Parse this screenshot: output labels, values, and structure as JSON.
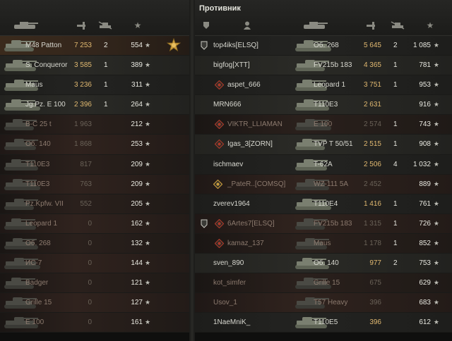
{
  "right_team_title": "Противник",
  "left_rows": [
    {
      "vehicle": "M48 Patton",
      "damage": "7 253",
      "frags": "2",
      "xp": "554",
      "self": true,
      "medal": true
    },
    {
      "vehicle": "S. Conqueror",
      "damage": "3 585",
      "frags": "1",
      "xp": "389"
    },
    {
      "vehicle": "Maus",
      "damage": "3 236",
      "frags": "1",
      "xp": "311"
    },
    {
      "vehicle": "Jg.Pz. E 100",
      "damage": "2 396",
      "frags": "1",
      "xp": "264"
    },
    {
      "vehicle": "B-C 25 t",
      "damage": "1 963",
      "frags": "",
      "xp": "212",
      "dead": true
    },
    {
      "vehicle": "Об. 140",
      "damage": "1 868",
      "frags": "",
      "xp": "253",
      "dead": true
    },
    {
      "vehicle": "T110E3",
      "damage": "817",
      "frags": "",
      "xp": "209",
      "dead": true
    },
    {
      "vehicle": "T110E3",
      "damage": "763",
      "frags": "",
      "xp": "209",
      "dead": true
    },
    {
      "vehicle": "Pz.Kpfw. VII",
      "damage": "552",
      "frags": "",
      "xp": "205",
      "dead": true
    },
    {
      "vehicle": "Leopard 1",
      "damage": "0",
      "frags": "",
      "xp": "162",
      "dead": true
    },
    {
      "vehicle": "Об. 268",
      "damage": "0",
      "frags": "",
      "xp": "132",
      "dead": true
    },
    {
      "vehicle": "ИС-7",
      "damage": "0",
      "frags": "",
      "xp": "144",
      "dead": true
    },
    {
      "vehicle": "Badger",
      "damage": "0",
      "frags": "",
      "xp": "121",
      "dead": true
    },
    {
      "vehicle": "Grille 15",
      "damage": "0",
      "frags": "",
      "xp": "127",
      "dead": true
    },
    {
      "vehicle": "E 100",
      "damage": "0",
      "frags": "",
      "xp": "161",
      "dead": true
    }
  ],
  "right_rows": [
    {
      "player": "top4iks[ELSQ]",
      "vehicle": "Об. 268",
      "damage": "5 645",
      "frags": "2",
      "xp": "1 085",
      "icon": "platoon"
    },
    {
      "player": "bigfog[XTT]",
      "vehicle": "FV215b 183",
      "damage": "4 365",
      "frags": "1",
      "xp": "781"
    },
    {
      "player": "aspet_666",
      "vehicle": "Leopard 1",
      "damage": "3 751",
      "frags": "1",
      "xp": "953",
      "icon": "clan-red"
    },
    {
      "player": "MRN666",
      "vehicle": "T110E3",
      "damage": "2 631",
      "frags": "",
      "xp": "916"
    },
    {
      "player": "VIKTR_LLIAMAN",
      "vehicle": "E 100",
      "damage": "2 574",
      "frags": "1",
      "xp": "743",
      "icon": "clan-red",
      "dead": true
    },
    {
      "player": "Igas_3[ZORN]",
      "vehicle": "TVP T 50/51",
      "damage": "2 515",
      "frags": "1",
      "xp": "908",
      "icon": "clan-red"
    },
    {
      "player": "ischmaev",
      "vehicle": "T-62A",
      "damage": "2 506",
      "frags": "4",
      "xp": "1 032"
    },
    {
      "player": "_PateR..[COMSQ]",
      "vehicle": "WZ-111 5A",
      "damage": "2 452",
      "frags": "",
      "xp": "889",
      "icon": "clan-gold",
      "dead": true
    },
    {
      "player": "zverev1964",
      "vehicle": "T110E4",
      "damage": "1 416",
      "frags": "1",
      "xp": "761"
    },
    {
      "player": "6Artes7[ELSQ]",
      "vehicle": "FV215b 183",
      "damage": "1 315",
      "frags": "1",
      "xp": "726",
      "icon": "platoon-clan",
      "dead": true
    },
    {
      "player": "kamaz_137",
      "vehicle": "Maus",
      "damage": "1 178",
      "frags": "1",
      "xp": "852",
      "icon": "clan-red",
      "dead": true
    },
    {
      "player": "sven_890",
      "vehicle": "Об. 140",
      "damage": "977",
      "frags": "2",
      "xp": "753"
    },
    {
      "player": "kot_simfer",
      "vehicle": "Grille 15",
      "damage": "675",
      "frags": "",
      "xp": "629",
      "dead": true
    },
    {
      "player": "Usov_1",
      "vehicle": "T57 Heavy",
      "damage": "396",
      "frags": "",
      "xp": "683",
      "dead": true
    },
    {
      "player": "1NaeMniK_",
      "vehicle": "T110E5",
      "damage": "396",
      "frags": "",
      "xp": "612"
    }
  ],
  "star_glyph": "★",
  "colors": {
    "damage": "#e0b870",
    "dead_name": "#8c7a6e",
    "self_row": "#3a2a1c"
  }
}
